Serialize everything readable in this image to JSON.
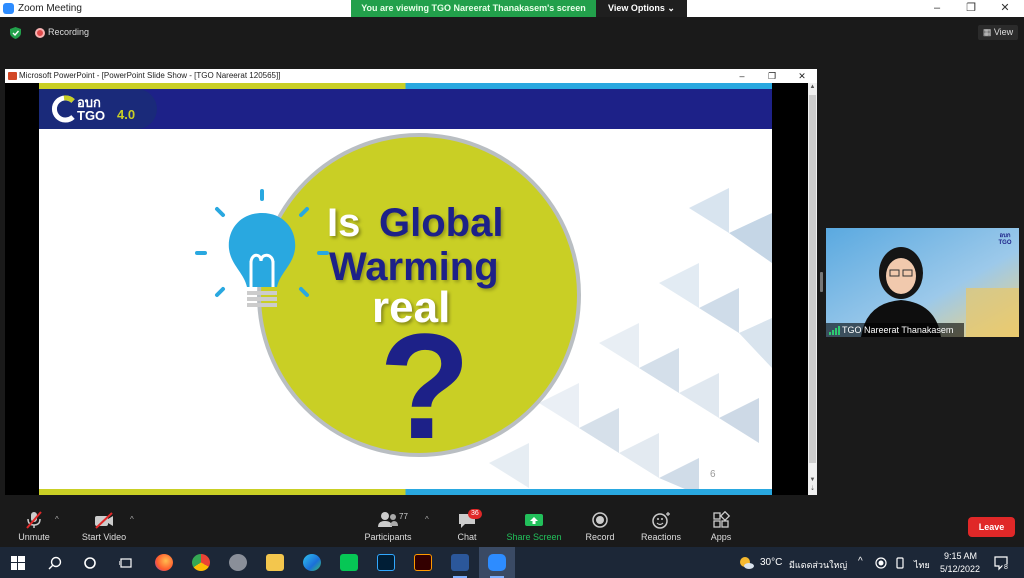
{
  "window": {
    "title": "Zoom Meeting",
    "banner": "You are viewing TGO Nareerat Thanakasem's screen",
    "view_options": "View Options",
    "minimize": "–",
    "maximize": "❐",
    "close": "✕"
  },
  "status": {
    "recording": "Recording",
    "view": "View"
  },
  "ppt": {
    "title": "Microsoft PowerPoint - [PowerPoint Slide Show - [TGO Nareerat 120565]]",
    "minimize": "–",
    "maximize": "❐",
    "close": "✕"
  },
  "slide": {
    "logo_line1": "อบก",
    "logo_line2": "TGO",
    "logo_version": "4.0",
    "headline_1": "Is",
    "headline_2": "Global",
    "headline_3": "Warming",
    "headline_4": "real",
    "question_mark": "?",
    "page_number": "6"
  },
  "participant": {
    "name": "TGO Nareerat Thanakasem",
    "logo_text": "อบก TGO"
  },
  "toolbar": {
    "unmute": "Unmute",
    "start_video": "Start Video",
    "participants": "Participants",
    "participants_count": "77",
    "chat": "Chat",
    "chat_badge": "36",
    "share_screen": "Share Screen",
    "record": "Record",
    "reactions": "Reactions",
    "apps": "Apps",
    "leave": "Leave"
  },
  "taskbar": {
    "weather": "30°C",
    "weather_text": "มีแดดส่วนใหญ่",
    "language": "ไทย",
    "time": "9:15 AM",
    "date": "5/12/2022",
    "notifications": "8"
  },
  "colors": {
    "zoom_blue": "#2d8cff",
    "banner_green": "#22a04b",
    "slide_navy": "#1d2188",
    "slide_lime": "#c9cf25",
    "leave_red": "#e02828",
    "share_green": "#22c05b"
  }
}
